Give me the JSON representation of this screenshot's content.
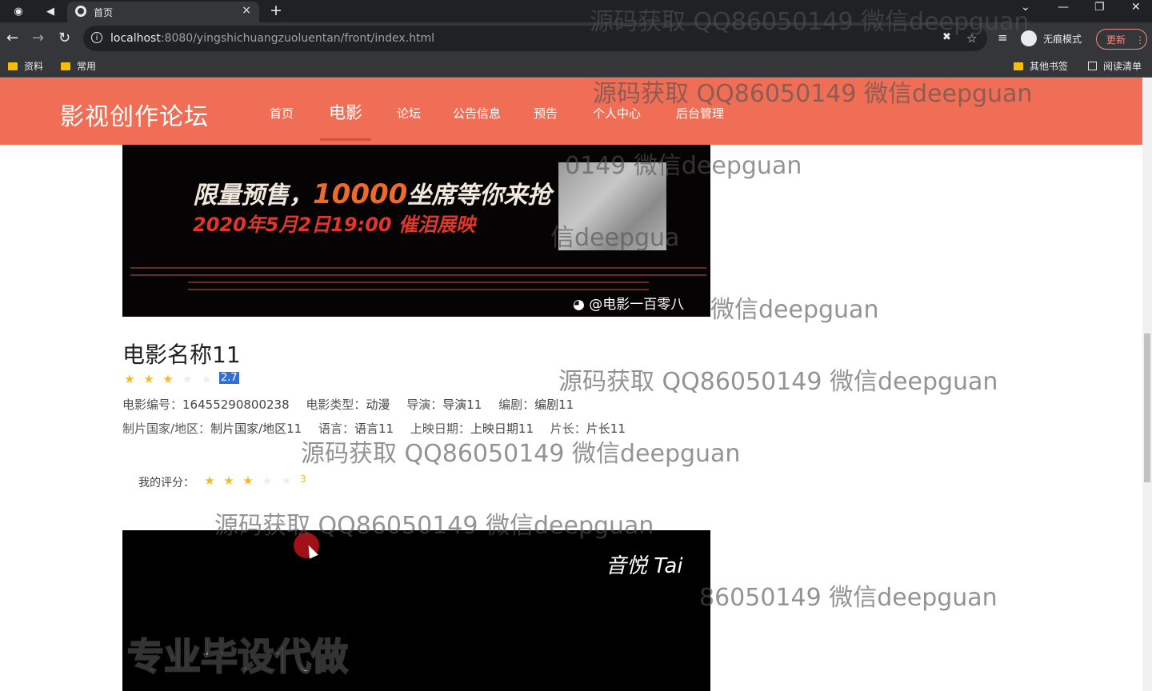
{
  "browser": {
    "tab_title": "首页",
    "tab_close": "×",
    "new_tab": "+",
    "url_host": "localhost",
    "url_path": ":8080/yingshichuangzuoluentan/front/index.html",
    "incognito_label": "无痕模式",
    "update_label": "更新",
    "bookmarks": [
      "资料",
      "常用"
    ],
    "bookmarks_right": [
      "其他书签",
      "阅读清单"
    ],
    "window_controls": [
      "⌄",
      "—",
      "❐",
      "✕"
    ]
  },
  "header": {
    "logo": "影视创作论坛",
    "nav": [
      "首页",
      "电影",
      "论坛",
      "公告信息",
      "预告",
      "个人中心",
      "后台管理"
    ],
    "active_index": 1
  },
  "poster": {
    "line1_a": "限量预售，",
    "line1_num": "10000",
    "line1_b": "坐席等你来抢",
    "line2": "2020年5月2日19:00 催泪展映",
    "weibo": "@电影一百零八"
  },
  "movie": {
    "title": "电影名称11",
    "rating": 2.7,
    "rating_text": "2.7",
    "stars_filled": 3,
    "fields_row1": [
      {
        "label": "电影编号：",
        "value": "16455290800238"
      },
      {
        "label": "电影类型：",
        "value": "动漫"
      },
      {
        "label": "导演：",
        "value": "导演11"
      },
      {
        "label": "编剧：",
        "value": "编剧11"
      }
    ],
    "fields_row2": [
      {
        "label": "制片国家/地区：",
        "value": "制片国家/地区11"
      },
      {
        "label": "语言：",
        "value": "语言11"
      },
      {
        "label": "上映日期：",
        "value": "上映日期11"
      },
      {
        "label": "片长：",
        "value": "片长11"
      }
    ],
    "my_rating_label": "我的评分：",
    "my_rating": 3,
    "my_rating_text": "3"
  },
  "video": {
    "signature": "音悦 Tai",
    "caption": "专业毕设代做"
  },
  "watermark": {
    "text_full": "源码获取 QQ86050149 微信deepguan",
    "frag_a": "0149 微信deepguan",
    "frag_b": "信deepgua",
    "frag_c": "微信deepguan",
    "frag_d": "86050149 微信deepguan"
  },
  "icons": {
    "star": "★",
    "back": "←",
    "forward": "→",
    "reload": "↻",
    "bookmark_star": "☆",
    "menu": "⋮"
  }
}
